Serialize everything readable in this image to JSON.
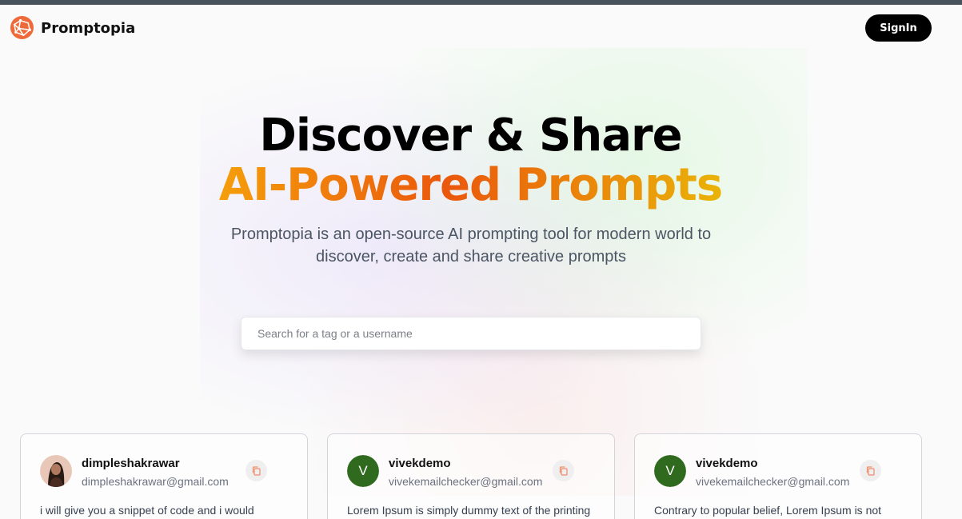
{
  "nav": {
    "brand": "Promptopia",
    "signin_label": "SignIn",
    "logo_icon": "promptopia-logo-icon"
  },
  "hero": {
    "line1": "Discover & Share",
    "line2": "AI-Powered Prompts",
    "description": "Promptopia is an open-source AI prompting tool for modern world to discover, create and share creative prompts"
  },
  "search": {
    "placeholder": "Search for a tag or a username",
    "value": ""
  },
  "prompts": [
    {
      "username": "dimpleshakrawar",
      "email": "dimpleshakrawar@gmail.com",
      "avatar": "photo",
      "text": "i will give you a snippet of code and i would"
    },
    {
      "username": "vivekdemo",
      "email": "vivekemailchecker@gmail.com",
      "avatar_letter": "V",
      "text": "Lorem Ipsum is simply dummy text of the printing"
    },
    {
      "username": "vivekdemo",
      "email": "vivekemailchecker@gmail.com",
      "avatar_letter": "V",
      "text": "Contrary to popular belief, Lorem Ipsum is not"
    }
  ],
  "colors": {
    "accent_orange": "#ea580c",
    "avatar_green": "#2f6a1f",
    "signin_bg": "#000000"
  }
}
